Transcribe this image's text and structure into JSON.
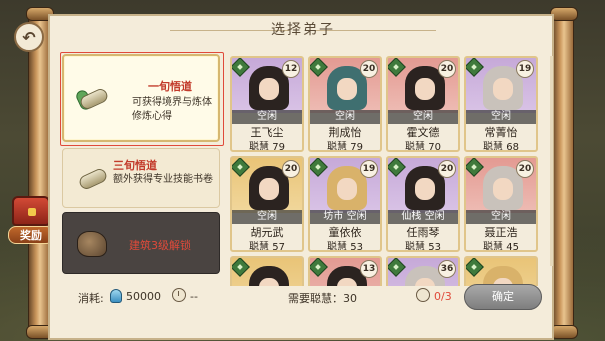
{
  "header": {
    "title": "选择弟子"
  },
  "reward": {
    "label": "奖励"
  },
  "options": [
    {
      "name": "一旬悟道",
      "desc": "可获得境界与炼体修炼心得",
      "selected": true
    },
    {
      "name": "三旬悟道",
      "desc": "额外获得专业技能书卷",
      "selected": false
    },
    {
      "name": "建筑3级解锁",
      "desc": "",
      "locked": true
    }
  ],
  "disciples": [
    {
      "name": "王飞尘",
      "stat": "聪慧 79",
      "status": "空闲",
      "level": "12",
      "rarity": "purple",
      "hair": "dark"
    },
    {
      "name": "荆成怡",
      "stat": "聪慧 79",
      "status": "空闲",
      "level": "20",
      "rarity": "red",
      "hair": "teal"
    },
    {
      "name": "霍文德",
      "stat": "聪慧 70",
      "status": "空闲",
      "level": "20",
      "rarity": "red",
      "hair": "dark"
    },
    {
      "name": "常菁怡",
      "stat": "聪慧 68",
      "status": "空闲",
      "level": "19",
      "rarity": "purple",
      "hair": "light"
    },
    {
      "name": "胡元武",
      "stat": "聪慧 57",
      "status": "空闲",
      "level": "20",
      "rarity": "gold",
      "hair": "dark"
    },
    {
      "name": "童依依",
      "stat": "聪慧 53",
      "status": "坊市 空闲",
      "level": "19",
      "rarity": "purple",
      "hair": "blond"
    },
    {
      "name": "任雨琴",
      "stat": "聪慧 53",
      "status": "仙栈 空闲",
      "level": "20",
      "rarity": "purple",
      "hair": "dark"
    },
    {
      "name": "聂正浩",
      "stat": "聪慧 45",
      "status": "空闲",
      "level": "20",
      "rarity": "red",
      "hair": "light"
    },
    {
      "name": "",
      "stat": "",
      "status": "",
      "level": "",
      "rarity": "gold",
      "hair": "dark"
    },
    {
      "name": "",
      "stat": "",
      "status": "",
      "level": "13",
      "rarity": "red",
      "hair": "dark"
    },
    {
      "name": "",
      "stat": "",
      "status": "",
      "level": "36",
      "rarity": "purple",
      "hair": "light"
    },
    {
      "name": "",
      "stat": "",
      "status": "",
      "level": "",
      "rarity": "gold",
      "hair": "blond"
    }
  ],
  "footer": {
    "cost_label": "消耗:",
    "cost_value": "50000",
    "time_value": "--",
    "need_text": "需要聪慧：30",
    "count_value": "0/3",
    "confirm_label": "确定"
  }
}
